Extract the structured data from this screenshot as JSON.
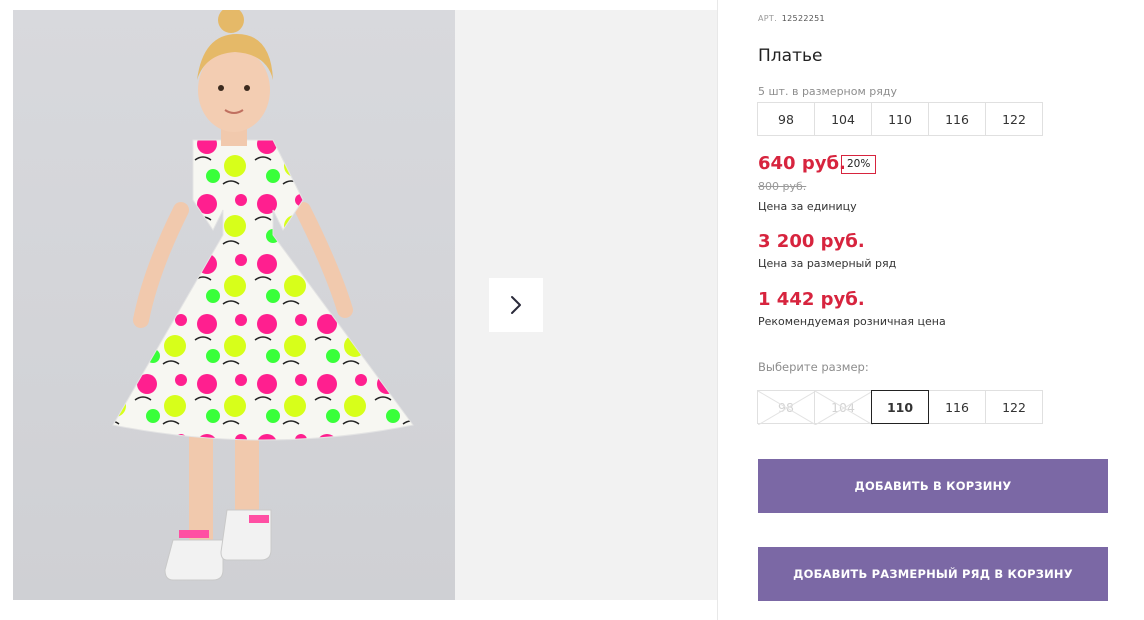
{
  "gallery": {
    "photo_alt": "Платье",
    "next_icon": "chevron-right-icon"
  },
  "product": {
    "article_label": "АРТ.",
    "article_value": "12522251",
    "title": "Платье",
    "row_note": "5 шт. в размерном ряду",
    "row_sizes": [
      "98",
      "104",
      "110",
      "116",
      "122"
    ],
    "price": "640 руб.",
    "discount": "20%",
    "old_price": "800 руб.",
    "price_unit_caption": "Цена за единицу",
    "price_set": "3 200 руб.",
    "price_set_caption": "Цена за размерный ряд",
    "price_rrp": "1 442 руб.",
    "price_rrp_caption": "Рекомендуемая розничная цена",
    "choose_size_label": "Выберите размер:",
    "choose_sizes": [
      {
        "label": "98",
        "state": "disabled"
      },
      {
        "label": "104",
        "state": "disabled"
      },
      {
        "label": "110",
        "state": "selected"
      },
      {
        "label": "116",
        "state": "available"
      },
      {
        "label": "122",
        "state": "available"
      }
    ],
    "add_to_cart_label": "Добавить в корзину",
    "add_set_to_cart_label": "Добавить размерный ряд в корзину"
  },
  "colors": {
    "accent_button": "#7b68a5",
    "price_red": "#d7243e"
  }
}
